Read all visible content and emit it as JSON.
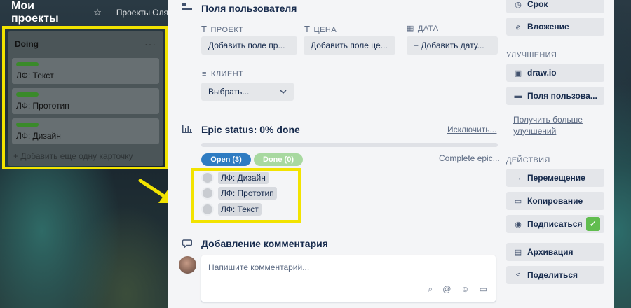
{
  "board": {
    "title": "Мои проекты",
    "team": "Проекты Оля",
    "list": {
      "title": "Doing",
      "menu": "···",
      "cards": [
        {
          "title": "ЛФ: Текст"
        },
        {
          "title": "ЛФ: Прототип"
        },
        {
          "title": "ЛФ: Дизайн"
        }
      ],
      "add_card": "+ Добавить еще одну карточку"
    }
  },
  "custom_fields": {
    "title": "Поля пользователя",
    "project": {
      "label": "ПРОЕКТ",
      "button": "Добавить поле пр..."
    },
    "price": {
      "label": "ЦЕНА",
      "button": "Добавить поле це..."
    },
    "date": {
      "label": "ДАТА",
      "button": "+ Добавить дату..."
    },
    "client": {
      "label": "КЛИЕНТ",
      "select": "Выбрать..."
    }
  },
  "epic": {
    "title": "Epic status: 0% done",
    "progress": 0,
    "exclude": "Исключить...",
    "open_pill": "Open (3)",
    "done_pill": "Done (0)",
    "complete": "Complete epic...",
    "items": [
      "ЛФ: Дизайн",
      "ЛФ: Прототип",
      "ЛФ: Текст"
    ]
  },
  "comment": {
    "title": "Добавление комментария",
    "placeholder": "Напишите комментарий..."
  },
  "sidebar": {
    "due": "Срок",
    "attachment": "Вложение",
    "powerups_heading": "УЛУЧШЕНИЯ",
    "drawio": "draw.io",
    "custom_fields": "Поля пользова...",
    "more_powerups": "Получить больше улучшений",
    "actions_heading": "ДЕЙСТВИЯ",
    "move": "Перемещение",
    "copy": "Копирование",
    "subscribe": "Подписаться",
    "archive": "Архивация",
    "share": "Поделиться"
  },
  "colors": {
    "accent_open": "#2f7cc2",
    "accent_done": "#a8d9a0",
    "highlight": "#f2e300",
    "success": "#61bd4f"
  }
}
